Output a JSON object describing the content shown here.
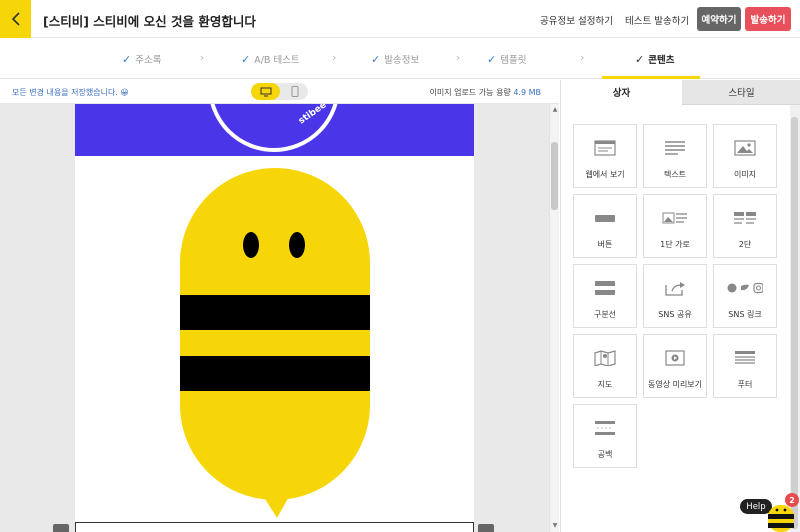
{
  "header": {
    "title": "[스티비] 스티비에 오신 것을 환영합니다",
    "share_settings": "공유정보 설정하기",
    "test_send": "테스트 발송하기",
    "schedule": "예약하기",
    "send": "발송하기",
    "colors": {
      "accent": "#f7d609",
      "schedule_bg": "#666666",
      "send_bg": "#e8505b"
    }
  },
  "steps": [
    {
      "label": "주소록",
      "done": true
    },
    {
      "label": "A/B 테스트",
      "done": true
    },
    {
      "label": "발송정보",
      "done": true
    },
    {
      "label": "템플릿",
      "done": true
    },
    {
      "label": "콘텐츠",
      "done": true,
      "active": true
    }
  ],
  "editor": {
    "save_status": "모든 변경 내용을 저장했습니다.",
    "save_emoji": "😀",
    "upload_label": "이미지 업로드 가능 용량",
    "upload_value": "4.9 MB",
    "view_modes": [
      "desktop-icon",
      "mobile-icon"
    ],
    "banner_color": "#4a36e8",
    "logo_text": "stibee"
  },
  "panel": {
    "tabs": [
      "상자",
      "스타일"
    ],
    "active_tab": "상자",
    "blocks": [
      {
        "label": "웹에서 보기",
        "icon": "web-view-icon"
      },
      {
        "label": "텍스트",
        "icon": "text-icon"
      },
      {
        "label": "이미지",
        "icon": "image-icon"
      },
      {
        "label": "버튼",
        "icon": "button-icon"
      },
      {
        "label": "1단 가로",
        "icon": "one-column-horizontal-icon"
      },
      {
        "label": "2단",
        "icon": "two-column-icon"
      },
      {
        "label": "구분선",
        "icon": "divider-icon"
      },
      {
        "label": "SNS 공유",
        "icon": "sns-share-icon"
      },
      {
        "label": "SNS 링크",
        "icon": "sns-link-icon"
      },
      {
        "label": "지도",
        "icon": "map-icon"
      },
      {
        "label": "동영상 미리보기",
        "icon": "video-preview-icon"
      },
      {
        "label": "푸터",
        "icon": "footer-icon"
      },
      {
        "label": "공백",
        "icon": "spacer-icon"
      }
    ]
  },
  "help": {
    "label": "Help",
    "badge": "2"
  }
}
